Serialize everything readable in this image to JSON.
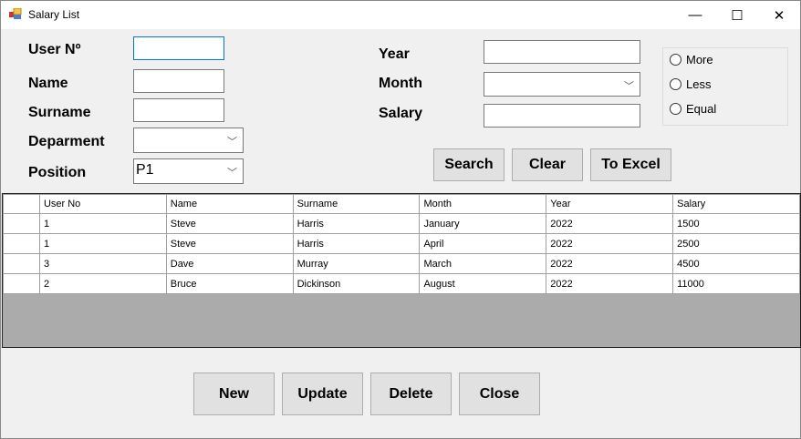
{
  "window": {
    "title": "Salary List",
    "minimize": "—",
    "maximize": "☐",
    "close": "✕"
  },
  "form": {
    "user_no_label": "User Nº",
    "name_label": "Name",
    "surname_label": "Surname",
    "department_label": "Deparment",
    "position_label": "Position",
    "position_value": "P1",
    "department_value": "",
    "year_label": "Year",
    "month_label": "Month",
    "salary_label": "Salary",
    "month_value": ""
  },
  "radios": [
    "More",
    "Less",
    "Equal"
  ],
  "buttons": {
    "search": "Search",
    "clear": "Clear",
    "excel": "To Excel",
    "new": "New",
    "update": "Update",
    "delete": "Delete",
    "close": "Close"
  },
  "grid": {
    "columns": [
      "User No",
      "Name",
      "Surname",
      "Month",
      "Year",
      "Salary"
    ],
    "rows": [
      [
        "1",
        "Steve",
        "Harris",
        "January",
        "2022",
        "1500"
      ],
      [
        "1",
        "Steve",
        "Harris",
        "April",
        "2022",
        "2500"
      ],
      [
        "3",
        "Dave",
        "Murray",
        "March",
        "2022",
        "4500"
      ],
      [
        "2",
        "Bruce",
        "Dickinson",
        "August",
        "2022",
        "11000"
      ]
    ]
  }
}
